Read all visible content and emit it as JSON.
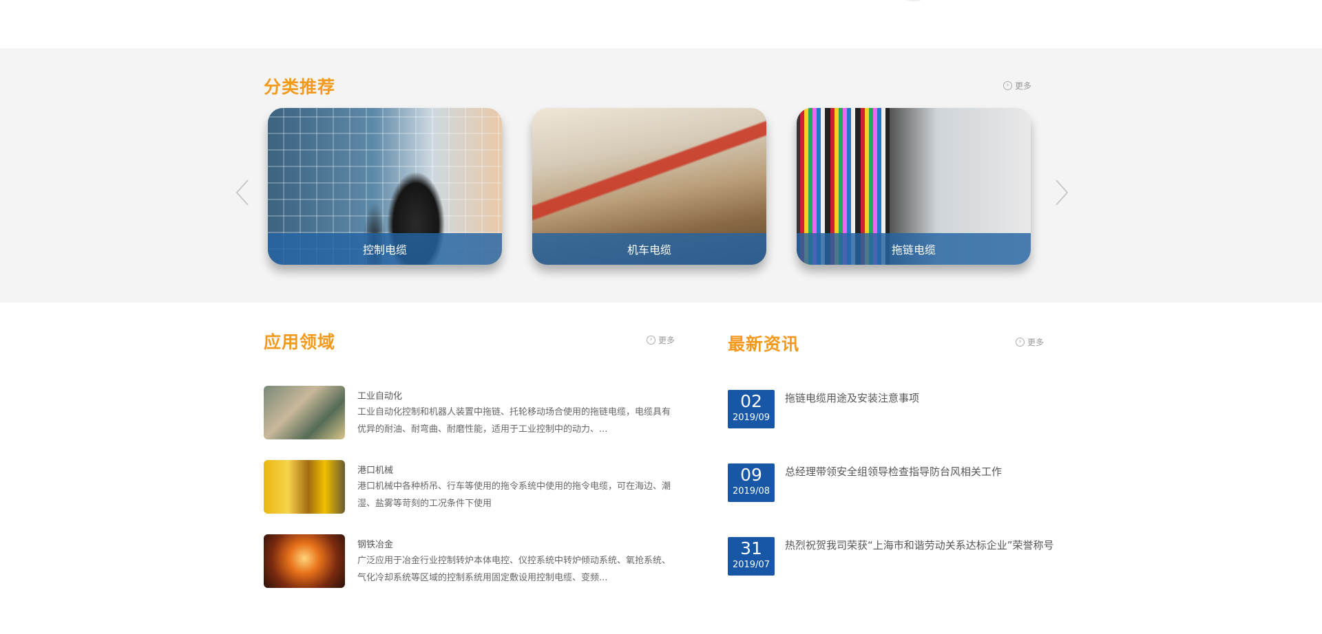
{
  "category_section": {
    "title": "分类推荐",
    "more": "更多",
    "cards": [
      {
        "caption": "控制电缆"
      },
      {
        "caption": "机车电缆"
      },
      {
        "caption": "拖链电缆"
      }
    ]
  },
  "application_section": {
    "title": "应用领域",
    "more": "更多",
    "items": [
      {
        "title": "工业自动化",
        "desc": "工业自动化控制和机器人装置中拖链、托轮移动场合使用的拖链电缆，电缆具有优异的耐油、耐弯曲、耐磨性能，适用于工业控制中的动力、..."
      },
      {
        "title": "港口机械",
        "desc": "港口机械中各种桥吊、行车等使用的拖令系统中使用的拖令电缆，可在海边、潮湿、盐雾等苛刻的工况条件下使用"
      },
      {
        "title": "钢铁冶金",
        "desc": "广泛应用于冶金行业控制转炉本体电控、仪控系统中转炉倾动系统、氧抢系统、气化冷却系统等区域的控制系统用固定敷设用控制电缆、变频..."
      }
    ]
  },
  "news_section": {
    "title": "最新资讯",
    "more": "更多",
    "items": [
      {
        "day": "02",
        "ym": "2019/09",
        "title": "拖链电缆用途及安装注意事项"
      },
      {
        "day": "09",
        "ym": "2019/08",
        "title": "总经理带领安全组领导检查指导防台风相关工作"
      },
      {
        "day": "31",
        "ym": "2019/07",
        "title": "热烈祝贺我司荣获“上海市和谐劳动关系达标企业”荣誉称号"
      }
    ]
  },
  "colors": {
    "accent": "#f39a1e",
    "date_badge": "#1757a6",
    "caption_bar": "#2464a4"
  }
}
